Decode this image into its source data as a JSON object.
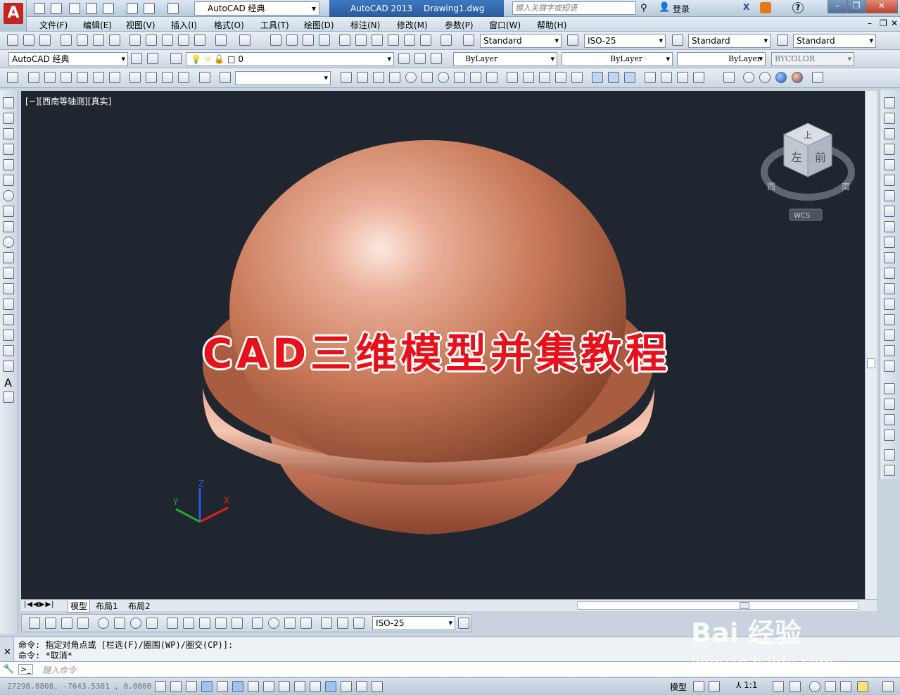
{
  "titlebar": {
    "workspace": "AutoCAD 经典",
    "app_name": "AutoCAD 2013",
    "file_name": "Drawing1.dwg",
    "search_placeholder": "键入关键字或短语",
    "login": "登录",
    "help": "?"
  },
  "menu": [
    "文件(F)",
    "编辑(E)",
    "视图(V)",
    "插入(I)",
    "格式(O)",
    "工具(T)",
    "绘图(D)",
    "标注(N)",
    "修改(M)",
    "参数(P)",
    "窗口(W)",
    "帮助(H)"
  ],
  "styles_toolbar": {
    "text_style": "Standard",
    "dim_style": "ISO-25",
    "table_style": "Standard",
    "multileader_style": "Standard"
  },
  "layers_toolbar": {
    "workspace": "AutoCAD 经典",
    "layer": "0",
    "color": "ByLayer",
    "linetype": "ByLayer",
    "lineweight": "ByLayer",
    "plot_style": "BYCOLOR"
  },
  "viewport": {
    "label": "[−][西南等轴测][真实]",
    "viewcube": {
      "top": "上",
      "left": "左",
      "front": "前",
      "west": "西",
      "south": "南",
      "wcs": "WCS"
    },
    "ucs": {
      "x": "X",
      "y": "Y",
      "z": "Z"
    }
  },
  "overlay_title": "CAD三维模型并集教程",
  "tabs": [
    "模型",
    "布局1",
    "布局2"
  ],
  "dim_toolbar": {
    "dim_style": "ISO-25"
  },
  "command": {
    "history_1": "命令: 指定对角点或 [栏选(F)/圈围(WP)/圈交(CP)]:",
    "history_2": "命令: *取消*",
    "placeholder": "键入命令"
  },
  "status": {
    "coords": "27298.8808, -7643.5301 , 0.0000",
    "model": "模型",
    "scale": "1:1"
  },
  "watermark": {
    "brand": "Bai 经验",
    "site": "jingyan.baidu.com"
  },
  "colors": {
    "viewport_bg": "#202630",
    "sphere": "#d78a6c",
    "overlay_text": "#e5111b",
    "title_active": "#2a5a9b"
  }
}
